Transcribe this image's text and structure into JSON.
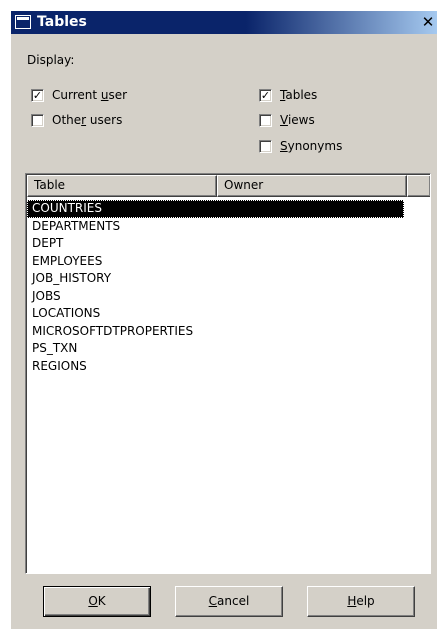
{
  "window": {
    "title": "Tables",
    "close_glyph": "✕"
  },
  "display": {
    "label": "Display:"
  },
  "owner_filters": [
    {
      "label_pre": "Current ",
      "label_u": "u",
      "label_post": "ser",
      "checked": true
    },
    {
      "label_pre": "Othe",
      "label_u": "r",
      "label_post": " users",
      "checked": false
    }
  ],
  "type_filters": [
    {
      "label_pre": "",
      "label_u": "T",
      "label_post": "ables",
      "checked": true
    },
    {
      "label_pre": "",
      "label_u": "V",
      "label_post": "iews",
      "checked": false
    },
    {
      "label_pre": "",
      "label_u": "S",
      "label_post": "ynonyms",
      "checked": false
    }
  ],
  "table_list": {
    "columns": [
      "Table",
      "Owner"
    ],
    "rows": [
      "COUNTRIES",
      "DEPARTMENTS",
      "DEPT",
      "EMPLOYEES",
      "JOB_HISTORY",
      "JOBS",
      "LOCATIONS",
      "MICROSOFTDTPROPERTIES",
      "PS_TXN",
      "REGIONS"
    ],
    "selected_index": 0
  },
  "buttons": {
    "ok": {
      "pre": "",
      "u": "O",
      "post": "K"
    },
    "cancel": {
      "pre": "",
      "u": "C",
      "post": "ancel"
    },
    "help": {
      "pre": "",
      "u": "H",
      "post": "elp"
    }
  },
  "check_glyph": "✓"
}
